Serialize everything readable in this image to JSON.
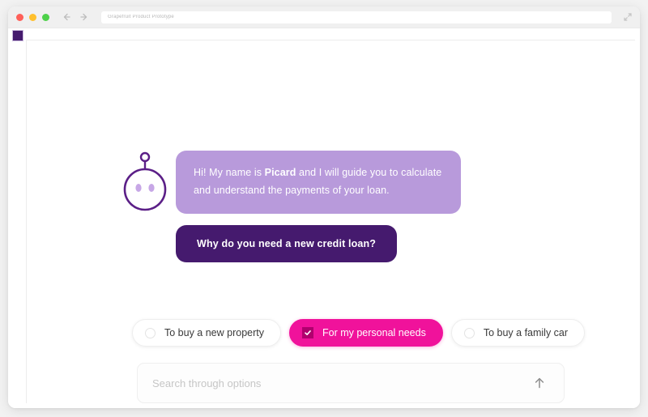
{
  "window": {
    "traffic_lights": [
      "close",
      "minimize",
      "maximize"
    ],
    "back_label": "Back",
    "forward_label": "Forward",
    "url_text": "Grapefruit Product Prototype",
    "expand_label": "Expand"
  },
  "colors": {
    "bot_bubble": "#B89ADB",
    "question_bubble": "#451A6E",
    "accent_selected": "#F0129B",
    "check_circle": "#B0006E",
    "badge": "#451A6E"
  },
  "conversation": {
    "avatar_name": "robot-avatar",
    "bot_message_prefix": "Hi! My name is ",
    "bot_message_name": "Picard",
    "bot_message_suffix": " and I will guide you to calculate and understand the payments of your loan.",
    "question": "Why do you need a new credit loan?"
  },
  "options": [
    {
      "label": "To buy a new property",
      "selected": false
    },
    {
      "label": "For my personal needs",
      "selected": true
    },
    {
      "label": "To buy a family car",
      "selected": false
    }
  ],
  "search": {
    "placeholder": "Search through options",
    "value": "",
    "submit_icon": "arrow-up-icon"
  }
}
